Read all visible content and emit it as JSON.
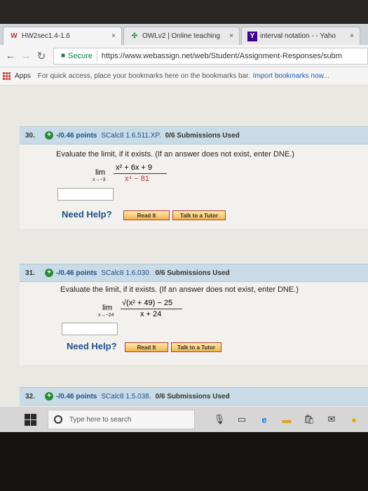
{
  "tabs": [
    {
      "title": "HW2sec1.4-1.6",
      "close": "×"
    },
    {
      "title": "OWLv2 | Online teaching",
      "close": "×"
    },
    {
      "title": "interval notation - - Yaho",
      "close": "×"
    }
  ],
  "toolbar": {
    "secure": "Secure",
    "url": "https://www.webassign.net/web/Student/Assignment-Responses/subm"
  },
  "bookmarks": {
    "apps": "Apps",
    "message": "For quick access, place your bookmarks here on the bookmarks bar.",
    "import_link": "Import bookmarks now..."
  },
  "questions": [
    {
      "number": "30.",
      "points": "-/0.46 points",
      "course": "SCalc8 1.6.511.XP.",
      "submissions": "0/6 Submissions Used",
      "prompt": "Evaluate the limit, if it exists. (If an answer does not exist, enter DNE.)",
      "lim": "lim",
      "lim_sub": "x→−3",
      "numerator": "x² + 6x + 9",
      "denominator": "x⁴ − 81",
      "need_help": "Need Help?",
      "read_it": "Read It",
      "talk_tutor": "Talk to a Tutor"
    },
    {
      "number": "31.",
      "points": "-/0.46 points",
      "course": "SCalc8 1.6.030.",
      "submissions": "0/6 Submissions Used",
      "prompt": "Evaluate the limit, if it exists. (If an answer does not exist, enter DNE.)",
      "lim": "lim",
      "lim_sub": "x→−24",
      "numerator": "√(x² + 49) − 25",
      "denominator": "x + 24",
      "need_help": "Need Help?",
      "read_it": "Read It",
      "talk_tutor": "Talk to a Tutor"
    },
    {
      "number": "32.",
      "points": "-/0.46 points",
      "course": "SCalc8 1.5.038.",
      "submissions": "0/6 Submissions Used"
    }
  ],
  "taskbar": {
    "search_placeholder": "Type here to search"
  }
}
